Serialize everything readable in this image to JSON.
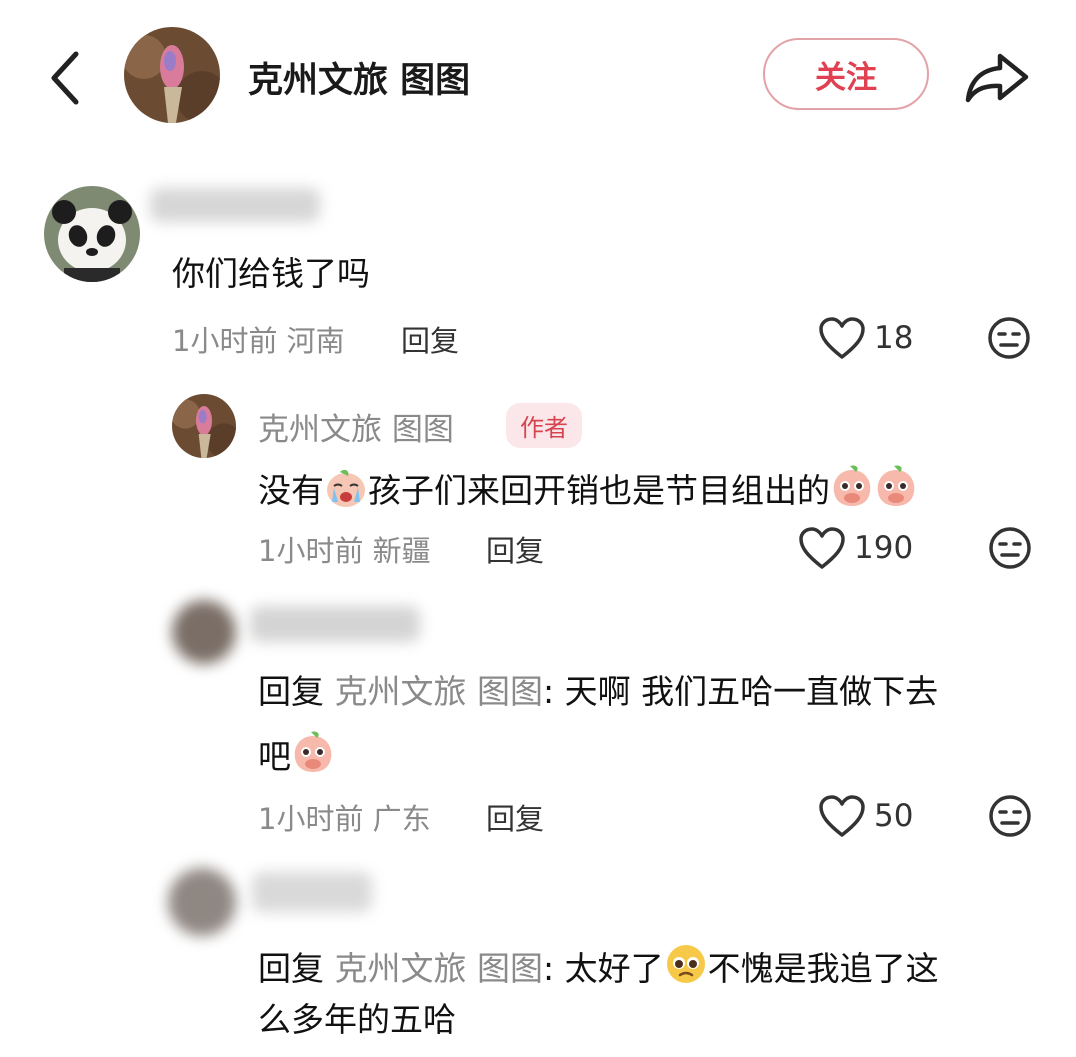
{
  "header": {
    "account_name": "克州文旅 图图",
    "follow_label": "关注"
  },
  "comments": [
    {
      "text": "你们给钱了吗",
      "time": "1小时前",
      "location": "河南",
      "reply_label": "回复",
      "likes": "18"
    },
    {
      "author": "克州文旅 图图",
      "author_badge": "作者",
      "text_part1": "没有",
      "text_part2": "孩子们来回开销也是节目组出的",
      "time": "1小时前",
      "location": "新疆",
      "reply_label": "回复",
      "likes": "190"
    },
    {
      "reply_prefix": "回复",
      "reply_target": "克州文旅 图图",
      "line1": ": 天啊  我们五哈一直做下去",
      "line2": "吧",
      "time": "1小时前",
      "location": "广东",
      "reply_label": "回复",
      "likes": "50"
    },
    {
      "reply_prefix": "回复",
      "reply_target": "克州文旅 图图",
      "line1_part1": ": 太好了",
      "line1_part2": "不愧是我追了这",
      "line2": "么多年的五哈"
    }
  ],
  "icons": {
    "back": "chevron-left-icon",
    "share": "share-arrow-icon",
    "like": "heart-outline-icon",
    "dislike": "meh-face-icon",
    "emoji_cry": "crying-face-emoji",
    "emoji_peach": "peach-face-emoji",
    "emoji_plead": "pleading-face-emoji"
  },
  "colors": {
    "accent": "#e04050",
    "badge_bg": "#fbe7ea",
    "meta_text": "#8a8a8a"
  }
}
